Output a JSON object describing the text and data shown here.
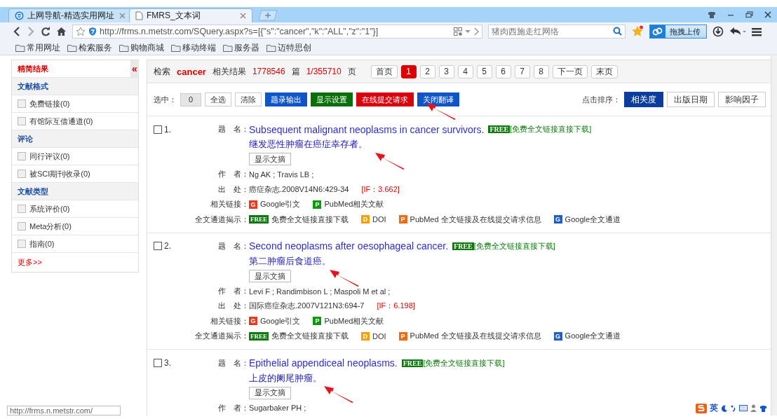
{
  "browser": {
    "tabs": [
      {
        "title": "上网导航-精选实用网址",
        "selected": false
      },
      {
        "title": "FMRS_文本词",
        "selected": true
      }
    ],
    "url": "http://frms.n.metstr.com/SQuery.aspx?s=[{\"s\":\"cancer\",\"k\":\"ALL\",\"z\":\"1\"}]",
    "search_placeholder": "猪肉西施走红网络",
    "upload_button": "拖拽上传",
    "bookmarks": [
      "常用网址",
      "检索服务",
      "购物商城",
      "移动终端",
      "服务器",
      "迈特思创"
    ]
  },
  "sidebar": {
    "title": "精简结果",
    "collapse": "«",
    "groups": [
      {
        "title": "文献格式",
        "items": [
          {
            "label": "免费链接(0)",
            "checked": false
          },
          {
            "label": "有馆际互借通道(0)",
            "checked": false
          }
        ]
      },
      {
        "title": "评论",
        "items": [
          {
            "label": "同行评议(0)",
            "checked": false
          },
          {
            "label": "被SCI期刊收录(0)",
            "checked": false
          }
        ]
      },
      {
        "title": "文献类型",
        "items": [
          {
            "label": "系统评价(0)",
            "checked": false
          },
          {
            "label": "Meta分析(0)",
            "checked": false
          },
          {
            "label": "指南(0)",
            "checked": false
          }
        ]
      }
    ],
    "more": "更多>>"
  },
  "summary": {
    "search_label": "检索",
    "query": "cancer",
    "results_label": "相关结果",
    "count": "1778546",
    "count_unit": "篇",
    "page": "1/355710",
    "page_unit": "页"
  },
  "pager": [
    {
      "label": "首页",
      "selected": false
    },
    {
      "label": "1",
      "selected": true
    },
    {
      "label": "2",
      "selected": false
    },
    {
      "label": "3",
      "selected": false
    },
    {
      "label": "4",
      "selected": false
    },
    {
      "label": "5",
      "selected": false
    },
    {
      "label": "6",
      "selected": false
    },
    {
      "label": "7",
      "selected": false
    },
    {
      "label": "8",
      "selected": false
    },
    {
      "label": "下一页",
      "selected": false
    },
    {
      "label": "末页",
      "selected": false
    }
  ],
  "toolbar": {
    "selected_label": "选中：",
    "selected_count": "0",
    "buttons": [
      {
        "label": "全选",
        "kind": "plain"
      },
      {
        "label": "清除",
        "kind": "plain"
      },
      {
        "label": "题录输出",
        "kind": "blue"
      },
      {
        "label": "显示设置",
        "kind": "green"
      },
      {
        "label": "在线提交请求",
        "kind": "red"
      },
      {
        "label": "关闭翻译",
        "kind": "blue"
      }
    ],
    "sort_label": "点击排序：",
    "sort_options": [
      {
        "label": "相关度",
        "selected": true
      },
      {
        "label": "出版日期",
        "selected": false
      },
      {
        "label": "影响因子",
        "selected": false
      }
    ]
  },
  "records": [
    {
      "checked": false,
      "number": "1.",
      "title_label": "题　名：",
      "title": "Subsequent malignant neoplasms in cancer survivors.",
      "free_badge": "FREE",
      "free_link": "[免费全文链接直接下载]",
      "translation": "继发恶性肿瘤在癌症幸存者。",
      "abstract_button": "显示文摘",
      "fields": [
        {
          "label": "作　者：",
          "value": "Ng AK ; Travis LB ;"
        },
        {
          "label": "出　处：",
          "value": "癌症杂志.2008V14N6:429-34",
          "impact": "[IF：3.662]"
        }
      ],
      "related_label": "相关链接：",
      "related": [
        {
          "badge": "G",
          "label": "Google引文",
          "color": "#e63c1e"
        },
        {
          "badge": "P",
          "label": "PubMed相关文献",
          "color": "#0a9a0a"
        }
      ],
      "fulltext_label": "全文通道揭示：",
      "fulltext": [
        {
          "badge": "FREE",
          "label": "免费全文链接直接下载",
          "color": "#0b7a0b"
        },
        {
          "badge": "D",
          "label": "DOI",
          "color": "#f5a000"
        },
        {
          "badge": "P",
          "label": "PubMed 全文链接及在线提交请求信息",
          "color": "#f06a14"
        },
        {
          "badge": "G",
          "label": "Google全文通道",
          "color": "#1f5fc4"
        }
      ]
    },
    {
      "checked": false,
      "number": "2.",
      "title_label": "题　名：",
      "title": "Second neoplasms after oesophageal cancer.",
      "free_badge": "FREE",
      "free_link": "[免费全文链接直接下载]",
      "translation": "第二肿瘤后食道癌。",
      "abstract_button": "显示文摘",
      "fields": [
        {
          "label": "作　者：",
          "value": "Levi F ; Randimbison L ; Maspoli M et al ;"
        },
        {
          "label": "出　处：",
          "value": "国际癌症杂志.2007V121N3:694-7",
          "impact": "[IF：6.198]"
        }
      ],
      "related_label": "相关链接：",
      "related": [
        {
          "badge": "G",
          "label": "Google引文",
          "color": "#e63c1e"
        },
        {
          "badge": "P",
          "label": "PubMed相关文献",
          "color": "#0a9a0a"
        }
      ],
      "fulltext_label": "全文通道揭示：",
      "fulltext": [
        {
          "badge": "FREE",
          "label": "免费全文链接直接下载",
          "color": "#0b7a0b"
        },
        {
          "badge": "D",
          "label": "DOI",
          "color": "#f5a000"
        },
        {
          "badge": "P",
          "label": "PubMed 全文链接及在线提交请求信息",
          "color": "#f06a14"
        },
        {
          "badge": "G",
          "label": "Google全文通道",
          "color": "#1f5fc4"
        }
      ]
    },
    {
      "checked": false,
      "number": "3.",
      "title_label": "题　名：",
      "title": "Epithelial appendiceal neoplasms.",
      "free_badge": "FREE",
      "free_link": "[免费全文链接直接下载]",
      "translation": "上皮的阑尾肿瘤。",
      "abstract_button": "显示文摘",
      "fields": [
        {
          "label": "作　者：",
          "value": "Sugarbaker PH ;"
        }
      ]
    }
  ],
  "status_url": "http://frms.n.metstr.com/",
  "ime": {
    "mode": "英"
  }
}
